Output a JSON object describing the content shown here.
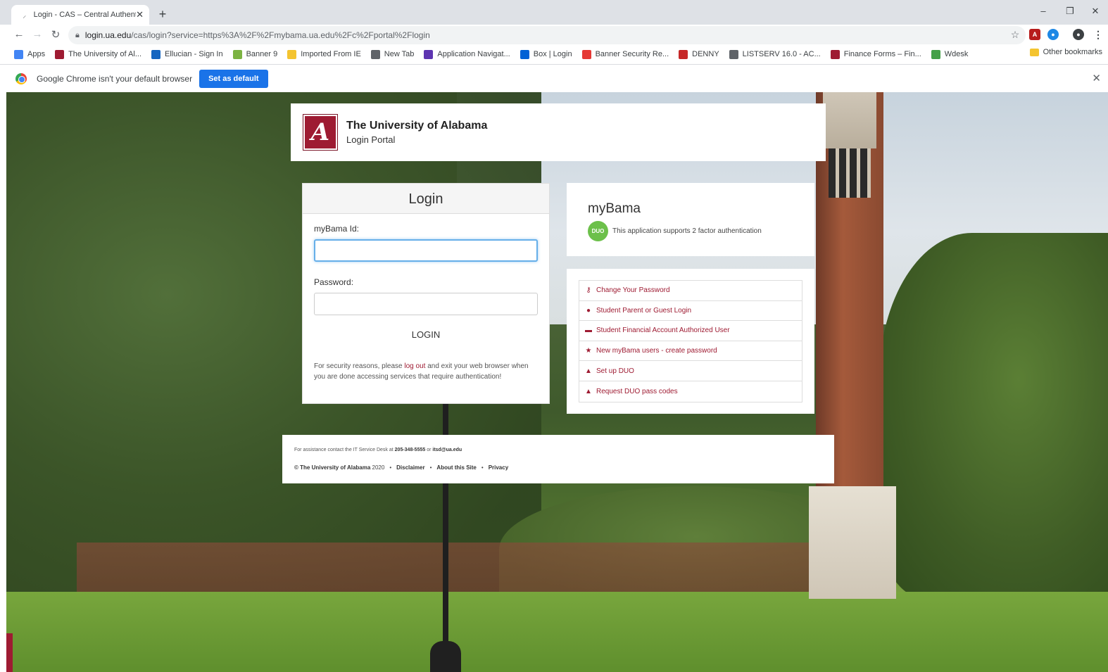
{
  "browser": {
    "tab_title": "Login - CAS – Central Authentica",
    "url_host": "login.ua.edu",
    "url_path": "/cas/login?service=https%3A%2F%2Fmybama.ua.edu%2Fc%2Fportal%2Flogin",
    "bookmarks": [
      {
        "label": "Apps",
        "color": "#4285f4"
      },
      {
        "label": "The University of Al...",
        "color": "#9e1b32"
      },
      {
        "label": "Ellucian - Sign In",
        "color": "#1565c0"
      },
      {
        "label": "Banner 9",
        "color": "#7cb342"
      },
      {
        "label": "Imported From IE",
        "color": "#f4c430"
      },
      {
        "label": "New Tab",
        "color": "#5f6368"
      },
      {
        "label": "Application Navigat...",
        "color": "#5e35b1"
      },
      {
        "label": "Box | Login",
        "color": "#0061d5"
      },
      {
        "label": "Banner Security Re...",
        "color": "#e53935"
      },
      {
        "label": "DENNY",
        "color": "#c62828"
      },
      {
        "label": "LISTSERV 16.0 - AC...",
        "color": "#5f6368"
      },
      {
        "label": "Finance Forms – Fin...",
        "color": "#9e1b32"
      },
      {
        "label": "Wdesk",
        "color": "#43a047"
      }
    ],
    "other_bookmarks": "Other bookmarks",
    "infobar_text": "Google Chrome isn't your default browser",
    "infobar_button": "Set as default"
  },
  "header": {
    "logo_letter": "A",
    "title": "The University of Alabama",
    "subtitle": "Login Portal"
  },
  "login": {
    "heading": "Login",
    "id_label": "myBama Id:",
    "id_value": "",
    "password_label": "Password:",
    "password_value": "",
    "button": "LOGIN",
    "security_pre": "For security reasons, please ",
    "security_link": "log out",
    "security_post": " and exit your web browser when you are done accessing services that require authentication!"
  },
  "mybama": {
    "title": "myBama",
    "duo_badge": "DUO",
    "note": "This application supports 2 factor authentication"
  },
  "links": [
    {
      "icon": "key-icon",
      "glyph": "⚷",
      "label": "Change Your Password"
    },
    {
      "icon": "user-icon",
      "glyph": "●",
      "label": "Student Parent or Guest Login"
    },
    {
      "icon": "credit-card-icon",
      "glyph": "▬",
      "label": "Student Financial Account Authorized User"
    },
    {
      "icon": "star-icon",
      "glyph": "★",
      "label": "New myBama users - create password"
    },
    {
      "icon": "lock-icon",
      "glyph": "▲",
      "label": "Set up DUO"
    },
    {
      "icon": "unlock-icon",
      "glyph": "▲",
      "label": "Request DUO pass codes"
    }
  ],
  "footer": {
    "assist_pre": "For assistance contact the IT Service Desk at ",
    "phone": "205-348-5555",
    "assist_mid": " or ",
    "email": "itsd@ua.edu",
    "copyright": "© The University of Alabama",
    "year": "2020",
    "disclaimer": "Disclaimer",
    "about": "About this Site",
    "privacy": "Privacy",
    "sep": "•"
  }
}
